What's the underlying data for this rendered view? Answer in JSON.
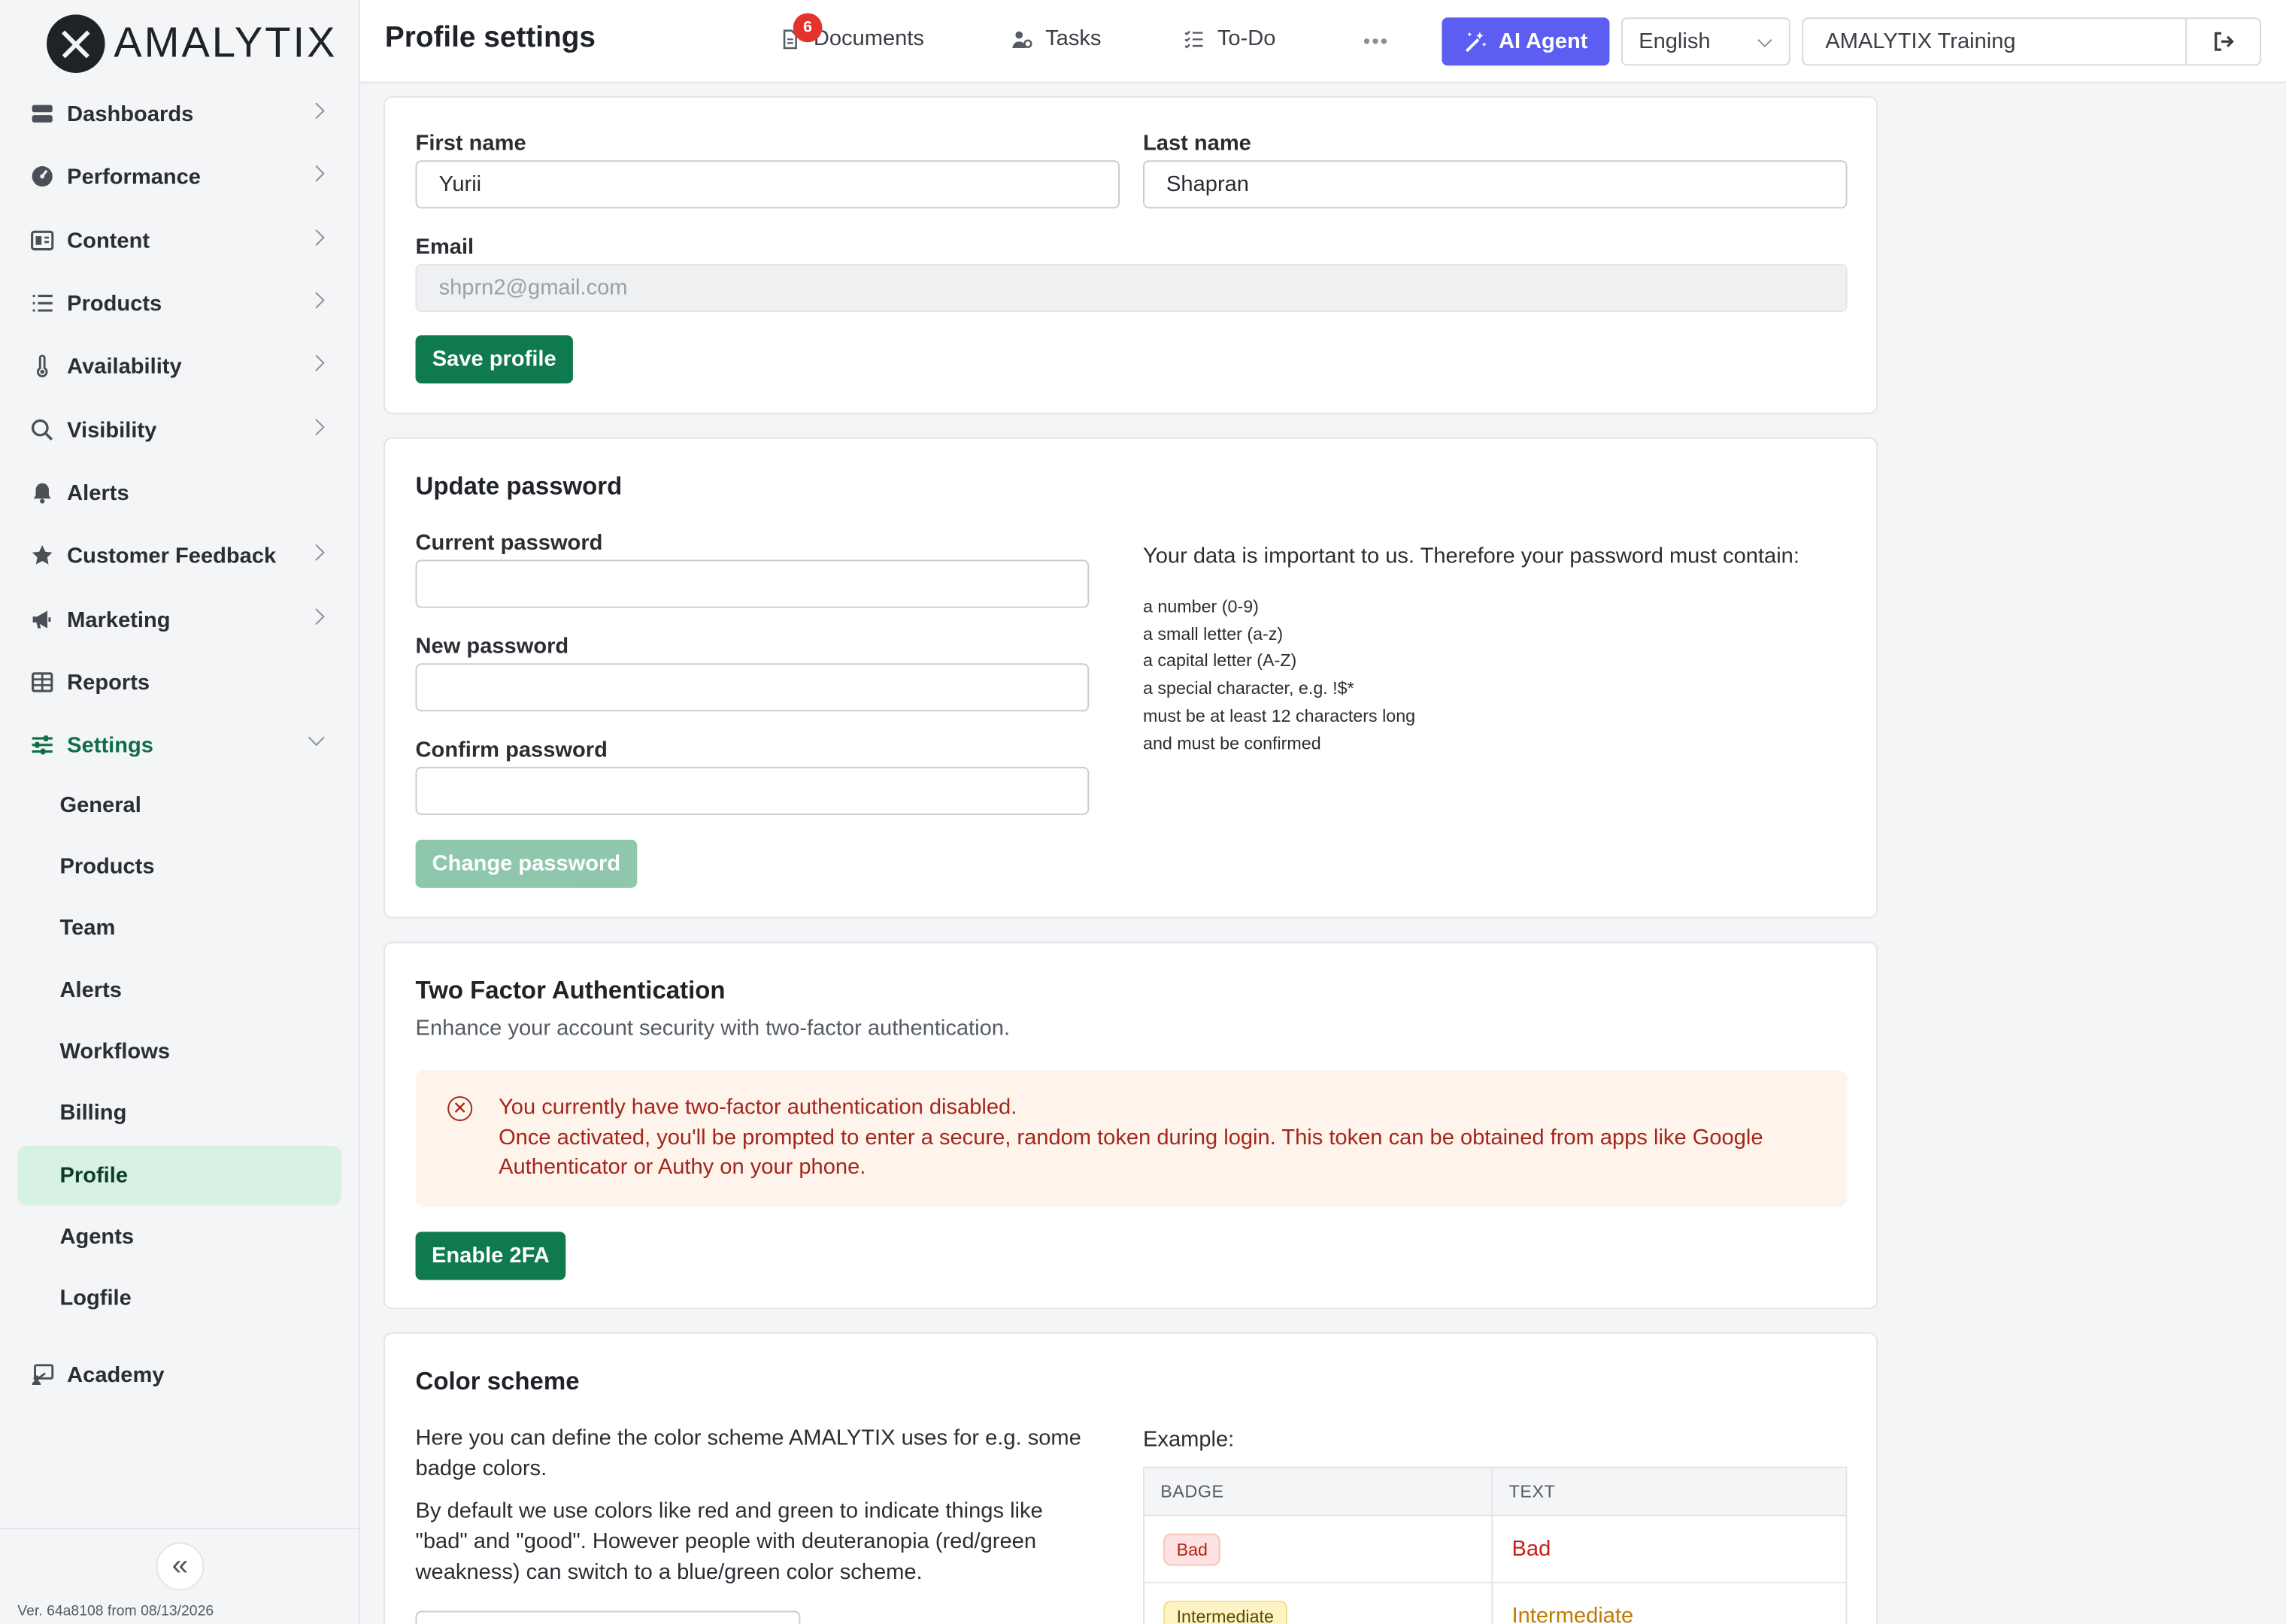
{
  "app": {
    "brand": "AMALYTIX",
    "version": "Ver. 64a8108 from 08/13/2026"
  },
  "header": {
    "title": "Profile settings",
    "nav": [
      {
        "label": "Documents",
        "icon": "document-icon",
        "count": "6"
      },
      {
        "label": "Tasks",
        "icon": "tasks-icon"
      },
      {
        "label": "To-Do",
        "icon": "todo-list-icon"
      }
    ],
    "more": "•••",
    "ai_agent": "AI Agent",
    "language": "English",
    "account": "AMALYTIX Training"
  },
  "sidebar": {
    "items": [
      {
        "label": "Dashboards",
        "icon": "dashboards-icon",
        "expandable": true
      },
      {
        "label": "Performance",
        "icon": "gauge-icon",
        "expandable": true
      },
      {
        "label": "Content",
        "icon": "content-icon",
        "expandable": true
      },
      {
        "label": "Products",
        "icon": "list-icon",
        "expandable": true
      },
      {
        "label": "Availability",
        "icon": "thermometer-icon",
        "expandable": true
      },
      {
        "label": "Visibility",
        "icon": "search-icon",
        "expandable": true
      },
      {
        "label": "Alerts",
        "icon": "bell-icon",
        "expandable": false
      },
      {
        "label": "Customer Feedback",
        "icon": "star-icon",
        "expandable": true
      },
      {
        "label": "Marketing",
        "icon": "megaphone-icon",
        "expandable": true
      },
      {
        "label": "Reports",
        "icon": "table-icon",
        "expandable": false
      },
      {
        "label": "Settings",
        "icon": "sliders-icon",
        "expandable": true,
        "active": true
      }
    ],
    "settings_sub": [
      "General",
      "Products",
      "Team",
      "Alerts",
      "Workflows",
      "Billing",
      "Profile",
      "Agents",
      "Logfile"
    ],
    "selected_sub": "Profile",
    "academy": {
      "label": "Academy",
      "icon": "academy-icon"
    }
  },
  "profile": {
    "first_name_label": "First name",
    "first_name": "Yurii",
    "last_name_label": "Last name",
    "last_name": "Shapran",
    "email_label": "Email",
    "email": "shprn2@gmail.com",
    "save": "Save profile"
  },
  "password": {
    "title": "Update password",
    "current_label": "Current password",
    "new_label": "New password",
    "confirm_label": "Confirm password",
    "button": "Change password",
    "intro": "Your data is important to us. Therefore your password must contain:",
    "rules": [
      "a number (0-9)",
      "a small letter (a-z)",
      "a capital letter (A-Z)",
      "a special character, e.g. !$*",
      "must be at least 12 characters long",
      "and must be confirmed"
    ]
  },
  "two_factor": {
    "title": "Two Factor Authentication",
    "subtitle": "Enhance your account security with two-factor authentication.",
    "alert_line1": "You currently have two-factor authentication disabled.",
    "alert_line2": "Once activated, you'll be prompted to enter a secure, random token during login. This token can be obtained from apps like Google Authenticator or Authy on your phone.",
    "button": "Enable 2FA"
  },
  "color_scheme": {
    "title": "Color scheme",
    "para1": "Here you can define the color scheme AMALYTIX uses for e.g. some badge colors.",
    "para2": "By default we use colors like red and green to indicate things like \"bad\" and \"good\". However people with deuteranopia (red/green weakness) can switch to a blue/green color scheme.",
    "example_label": "Example:",
    "columns": [
      "BADGE",
      "TEXT"
    ],
    "rows": [
      {
        "badge": "Bad",
        "text": "Bad",
        "badge_bg": "#fde2e1",
        "badge_fg": "#b42318",
        "text_color": "#c81e1e"
      },
      {
        "badge": "Intermediate",
        "text": "Intermediate",
        "badge_bg": "#fdf3c4",
        "badge_fg": "#5c4a00",
        "text_color": "#c47a00"
      }
    ]
  },
  "colors": {
    "accent": "#0e7a4d",
    "ai": "#5b5ef0",
    "active_bg": "#d7f2e2"
  }
}
